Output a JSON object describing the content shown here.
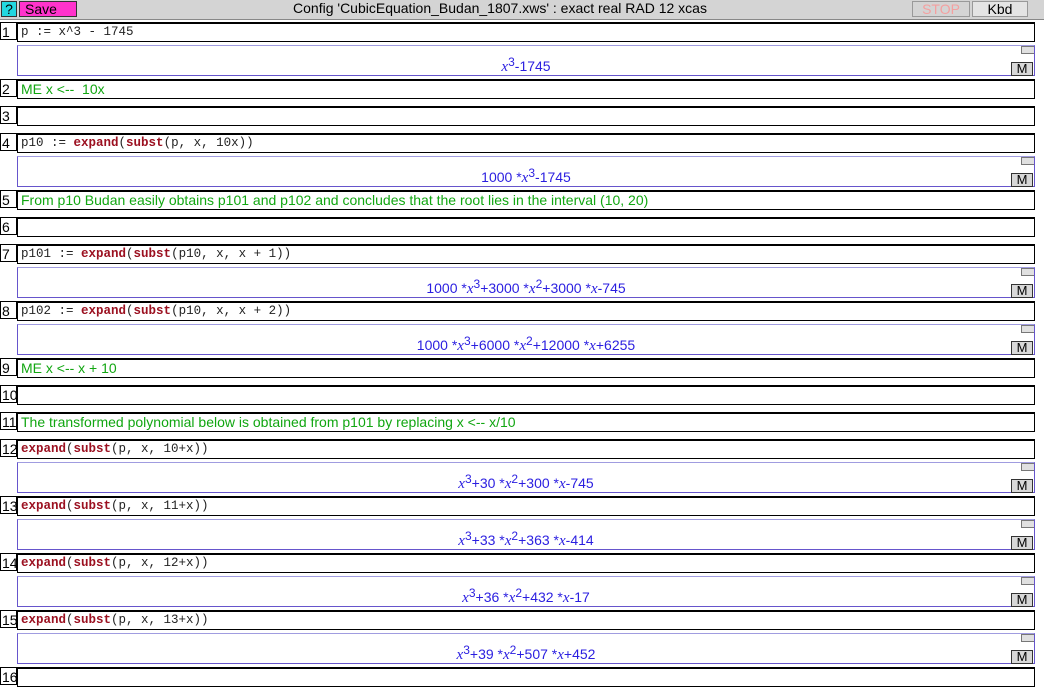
{
  "topbar": {
    "help_label": "?",
    "save_label": "Save",
    "title": "Config 'CubicEquation_Budan_1807.xws' : exact real RAD 12 xcas",
    "stop_label": "STOP",
    "kbd_label": "Kbd"
  },
  "levels": [
    {
      "num": "1",
      "code": "p := x^3 - 1745",
      "out": "x^3 -1745"
    },
    {
      "num": "2",
      "comment": "ME x <--  10x"
    },
    {
      "num": "3"
    },
    {
      "num": "4",
      "code": "p10 := expand(subst(p, x, 10x))",
      "out": "1000 * x^3 -1745"
    },
    {
      "num": "5",
      "comment": "From p10 Budan easily obtains p101 and p102 and concludes that the root lies in the interval (10, 20)"
    },
    {
      "num": "6"
    },
    {
      "num": "7",
      "code": "p101 := expand(subst(p10, x, x + 1))",
      "out": "1000*x^3 + 3000*x^2 + 3000*x - 745"
    },
    {
      "num": "8",
      "code": "p102 := expand(subst(p10, x, x + 2))",
      "out": "1000*x^3 + 6000*x^2 + 12000*x + 6255"
    },
    {
      "num": "9",
      "comment": "ME x <-- x + 10"
    },
    {
      "num": "10"
    },
    {
      "num": "11",
      "comment": "The transformed polynomial below is obtained from p101 by replacing x <-- x/10"
    },
    {
      "num": "12",
      "code": "expand(subst(p, x, 10+x))",
      "out": "x^3 + 30*x^2 + 300*x - 745"
    },
    {
      "num": "13",
      "code": "expand(subst(p, x, 11+x))",
      "out": "x^3 + 33*x^2 + 363*x - 414"
    },
    {
      "num": "14",
      "code": "expand(subst(p, x, 12+x))",
      "out": "x^3 + 36*x^2 + 432*x - 17"
    },
    {
      "num": "15",
      "code": "expand(subst(p, x, 13+x))",
      "out": "x^3 + 39*x^2 + 507*x + 452"
    },
    {
      "num": "16"
    }
  ],
  "output_button_label": "M",
  "colors": {
    "comment": "#11a611",
    "keyword": "#9b1020",
    "math": "#2a1ee0",
    "save": "#ff33cc",
    "help": "#22d8e0"
  }
}
